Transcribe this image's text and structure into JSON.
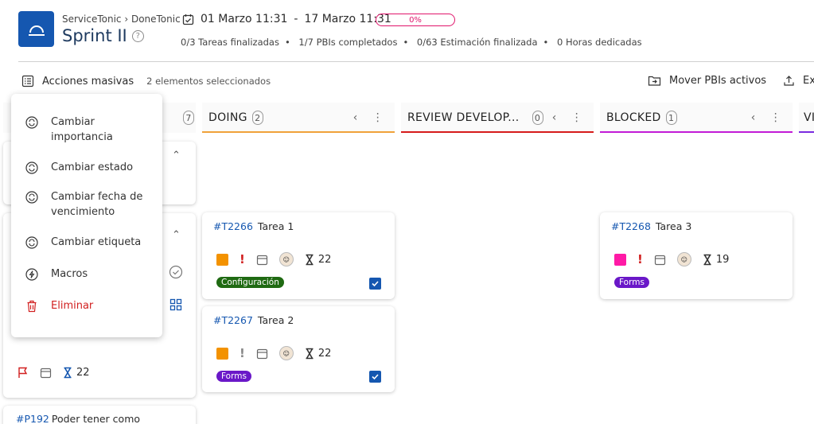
{
  "header": {
    "breadcrumb": "ServiceTonic › DoneTonic",
    "title": "Sprint II",
    "date_start": "01 Marzo 11:31",
    "date_sep": "-",
    "date_end": "17 Marzo 11:31",
    "progress_label": "0%",
    "progress_value": 0,
    "stats": [
      "0/3 Tareas finalizadas",
      "1/7 PBIs completados",
      "0/63 Estimación finalizada",
      "0 Horas dedicadas"
    ]
  },
  "toolbar": {
    "bulk_label": "Acciones masivas",
    "selected_label": "2 elementos seleccionados",
    "move_label": "Mover PBIs activos",
    "export_label": "Ex"
  },
  "colors": {
    "brand": "#1557b0",
    "doing": "#f0a23a",
    "review": "#d61b1b",
    "blocked": "#c21bd6",
    "next": "#7b2be0",
    "priority_orange": "#f39200",
    "priority_pink": "#ff1aa6",
    "tag_green": "#1f6a12",
    "tag_purple": "#6a18c8",
    "danger": "#d11f1f"
  },
  "columns": [
    {
      "title": "DOING",
      "count": "2"
    },
    {
      "title": "REVIEW DEVELOP...",
      "count": "0"
    },
    {
      "title": "BLOCKED",
      "count": "1"
    },
    {
      "title": "VI"
    }
  ],
  "first_column_count": "7",
  "cards": {
    "t2266": {
      "id": "#T2266",
      "title": "Tarea 1",
      "hours": "22",
      "tag": "Configuración"
    },
    "t2267": {
      "id": "#T2267",
      "title": "Tarea 2",
      "hours": "22",
      "tag": "Forms"
    },
    "t2268": {
      "id": "#T2268",
      "title": "Tarea 3",
      "hours": "19",
      "tag": "Forms"
    },
    "pbi_hours": "22",
    "p192": {
      "id": "#P192",
      "title": "Poder tener como"
    }
  },
  "menu": {
    "items": [
      {
        "label": "Cambiar importancia"
      },
      {
        "label": "Cambiar estado"
      },
      {
        "label": "Cambiar fecha de vencimiento"
      },
      {
        "label": "Cambiar etiqueta"
      },
      {
        "label": "Macros"
      },
      {
        "label": "Eliminar"
      }
    ]
  }
}
